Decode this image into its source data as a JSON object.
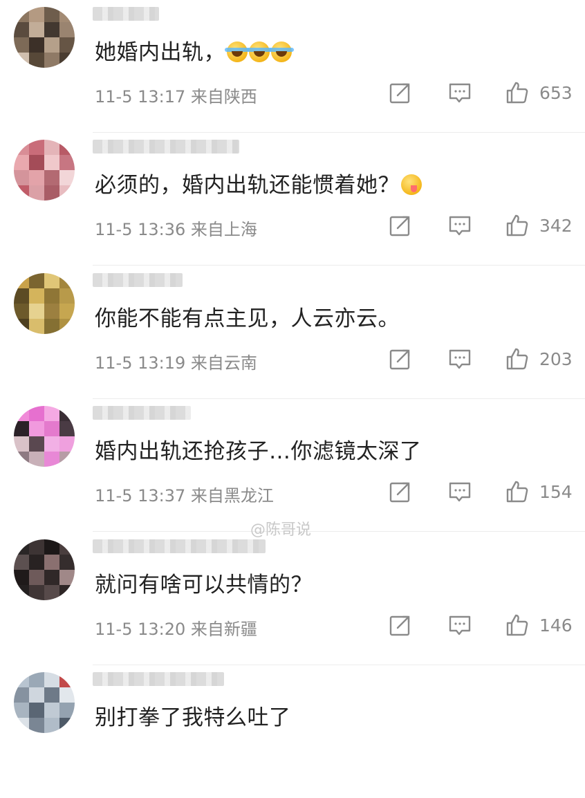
{
  "icons": {
    "share": "share-icon",
    "reply": "comment-icon",
    "like": "thumbs-up-icon"
  },
  "watermark": "@陈哥说",
  "comments": [
    {
      "text": "她婚内出轨，",
      "emoji": [
        "laugh-cry",
        "laugh-cry",
        "laugh-cry"
      ],
      "time": "11-5 13:17",
      "location": "来自陕西",
      "likes": "653",
      "avatar_colors": [
        "#8c7660",
        "#b49a82",
        "#6e5d4c",
        "#a38b74",
        "#5a4b3e",
        "#c2ad98",
        "#423830",
        "#9a8470",
        "#7d6a57",
        "#3c3028",
        "#b5a08a",
        "#665545",
        "#d0bfae",
        "#574838",
        "#8f7a66",
        "#4a3d31"
      ]
    },
    {
      "text": "必须的，婚内出轨还能惯着她？",
      "emoji": [
        "tongue"
      ],
      "time": "11-5 13:36",
      "location": "来自上海",
      "likes": "342",
      "avatar_colors": [
        "#d98d96",
        "#c96c79",
        "#e4b4b8",
        "#b85a66",
        "#e9a8ae",
        "#a44c58",
        "#f0c8cb",
        "#c77682",
        "#d4949b",
        "#e3a3a9",
        "#b36a72",
        "#f2d6d8",
        "#c05c68",
        "#dba0a6",
        "#a95d66",
        "#e8bcc0"
      ]
    },
    {
      "text": "你能不能有点主见，人云亦云。",
      "emoji": [],
      "time": "11-5 13:19",
      "location": "来自云南",
      "likes": "203",
      "avatar_colors": [
        "#c9a24a",
        "#7b6530",
        "#e0c677",
        "#a3863d",
        "#5c4b24",
        "#d4b45c",
        "#8f7636",
        "#b89a4a",
        "#6d5a2b",
        "#e6d290",
        "#9c8040",
        "#c6a650",
        "#4d3f1f",
        "#d9bd6c",
        "#857033",
        "#b09242"
      ]
    },
    {
      "text": "婚内出轨还抢孩子…你滤镜太深了",
      "emoji": [],
      "time": "11-5 13:37",
      "location": "来自黑龙江",
      "likes": "154",
      "avatar_colors": [
        "#f08ad8",
        "#e670cf",
        "#f5a9e3",
        "#3a2e35",
        "#2b2228",
        "#f19ade",
        "#e47acd",
        "#4a3b44",
        "#d9c2c8",
        "#5a4850",
        "#f2b0e5",
        "#efa0de",
        "#8e7a82",
        "#c8b0b8",
        "#e888d6",
        "#b79ca6"
      ]
    },
    {
      "text": "就问有啥可以共情的？",
      "emoji": [],
      "time": "11-5 13:20",
      "location": "来自新疆",
      "likes": "146",
      "avatar_colors": [
        "#2a2626",
        "#3d3434",
        "#1c1818",
        "#4a3e3e",
        "#5c5050",
        "#282222",
        "#8a7070",
        "#352d2d",
        "#1f1a1a",
        "#6e5a5a",
        "#302828",
        "#a08888",
        "#242020",
        "#403636",
        "#574a4a",
        "#2e2626"
      ]
    },
    {
      "text": "别打拳了我特么吐了",
      "emoji": [],
      "time": "",
      "location": "",
      "likes": "",
      "avatar_colors": [
        "#b8c4d0",
        "#9aa8b6",
        "#d6dde4",
        "#c24a4a",
        "#8692a0",
        "#cfd6de",
        "#6e7a88",
        "#e2e7ec",
        "#a8b4c0",
        "#5a6674",
        "#c0cad4",
        "#94a2b0",
        "#dce2e8",
        "#7a8694",
        "#b0bcc8",
        "#4e5a68"
      ]
    }
  ]
}
